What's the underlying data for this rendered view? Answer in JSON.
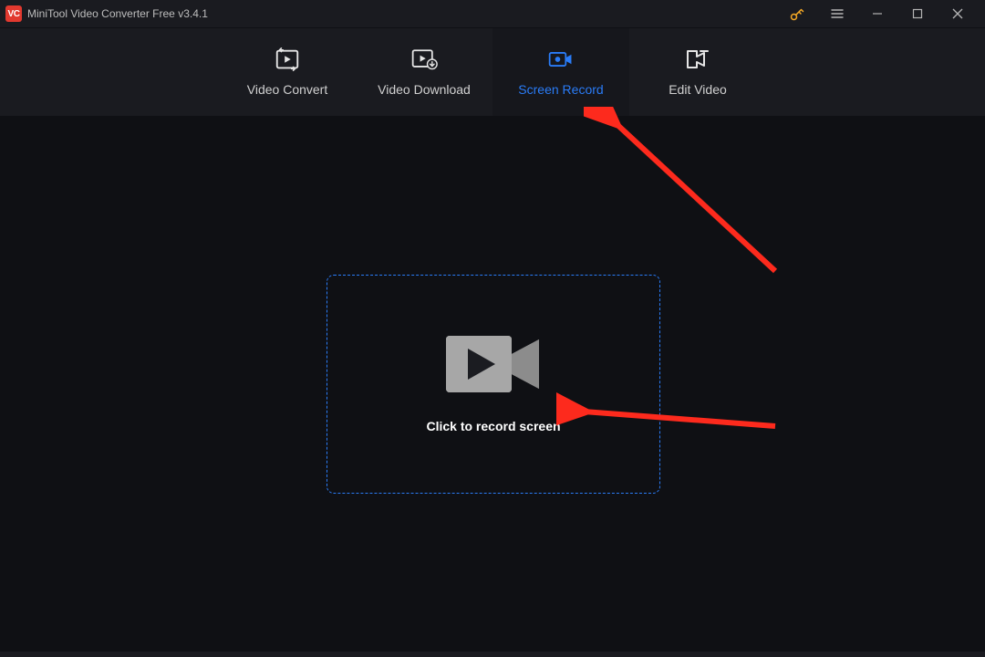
{
  "titleBar": {
    "title": "MiniTool Video Converter Free v3.4.1"
  },
  "nav": {
    "items": [
      {
        "label": "Video Convert"
      },
      {
        "label": "Video Download"
      },
      {
        "label": "Screen Record"
      },
      {
        "label": "Edit Video"
      }
    ]
  },
  "main": {
    "recordHint": "Click to record screen"
  },
  "colors": {
    "accent": "#2a7cf7",
    "arrow": "#fd2a1d"
  }
}
